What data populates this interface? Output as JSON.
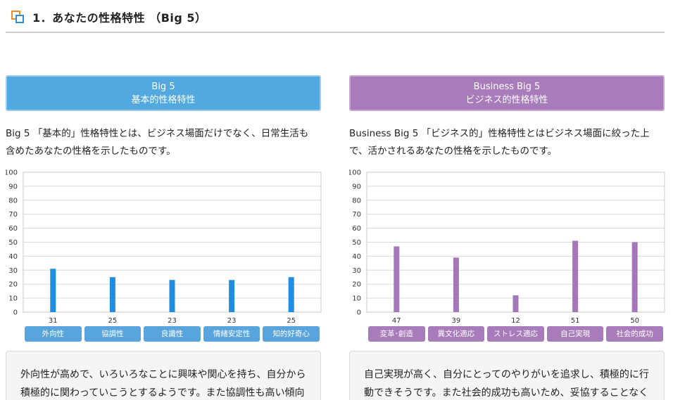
{
  "header": {
    "title": "1．あなたの性格特性 （Big 5）"
  },
  "panels": [
    {
      "title_line1": "Big 5",
      "title_line2": "基本的性格特性",
      "desc_line1": "Big 5 「基本的」性格特性とは、ビジネス場面だけでなく、日常生活も",
      "desc_line2": "含めたあなたの性格を示したものです。",
      "color": "#1f8ee0",
      "comment_line1": "外向性が高めで、いろいろなことに興味や関心を持ち、自分から",
      "comment_line2": "積極的に関わっていこうとするようです。また協調性も高い傾向"
    },
    {
      "title_line1": "Business Big 5",
      "title_line2": "ビジネス的性格特性",
      "desc_line1": "Business Big 5 「ビジネス的」性格特性とはビジネス場面に絞った上",
      "desc_line2": "で、活かされるあなたの性格を示したものです。",
      "color": "#a477b9",
      "comment_line1": "自己実現が高く、自分にとってのやりがいを追求し、積極的に行",
      "comment_line2": "動できそうです。また社会的成功も高いため、妥協することなく"
    }
  ],
  "chart_data": [
    {
      "type": "bar",
      "categories": [
        "外向性",
        "協調性",
        "良識性",
        "情緒安定性",
        "知的好奇心"
      ],
      "values": [
        31,
        25,
        23,
        23,
        25
      ],
      "ylim": [
        0,
        100
      ],
      "yticks": [
        0,
        10,
        20,
        30,
        40,
        50,
        60,
        70,
        80,
        90,
        100
      ],
      "grid": true
    },
    {
      "type": "bar",
      "categories": [
        "変革･創造",
        "異文化適応",
        "ストレス適応",
        "自己実現",
        "社会的成功"
      ],
      "values": [
        47,
        39,
        12,
        51,
        50
      ],
      "ylim": [
        0,
        100
      ],
      "yticks": [
        0,
        10,
        20,
        30,
        40,
        50,
        60,
        70,
        80,
        90,
        100
      ],
      "grid": true
    }
  ]
}
